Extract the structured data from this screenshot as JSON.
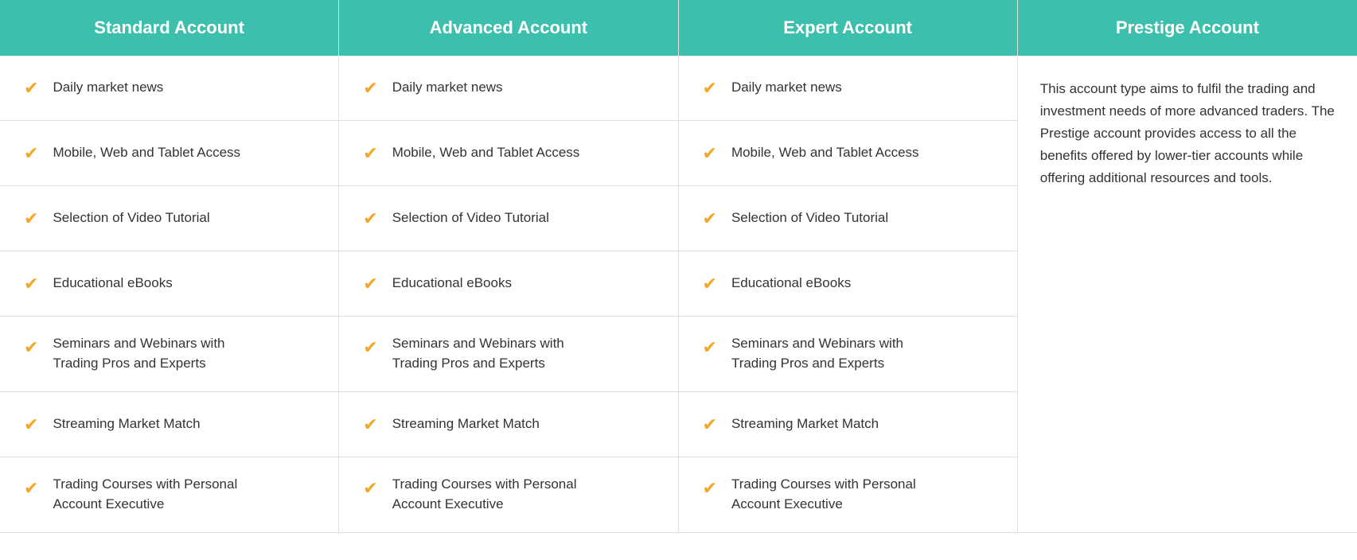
{
  "headers": [
    {
      "label": "Standard Account"
    },
    {
      "label": "Advanced Account"
    },
    {
      "label": "Expert Account"
    },
    {
      "label": "Prestige Account"
    }
  ],
  "prestige_description": "This account type aims to fulfil the trading and investment needs of more advanced traders. The Prestige account provides access to all the benefits offered by lower-tier accounts while offering additional resources and tools.",
  "features": [
    {
      "text": "Daily market news",
      "multiline": false,
      "line2": ""
    },
    {
      "text": "Mobile, Web and Tablet Access",
      "multiline": false,
      "line2": ""
    },
    {
      "text": "Selection of Video Tutorial",
      "multiline": false,
      "line2": ""
    },
    {
      "text": "Educational eBooks",
      "multiline": false,
      "line2": ""
    },
    {
      "text": "Seminars and Webinars with",
      "multiline": true,
      "line2": "Trading Pros and Experts"
    },
    {
      "text": "Streaming Market Match",
      "multiline": false,
      "line2": ""
    },
    {
      "text": "Trading Courses with Personal",
      "multiline": true,
      "line2": "Account Executive"
    }
  ],
  "checkmark": "✔",
  "colors": {
    "header_bg": "#3dbfad",
    "check_color": "#f5a623",
    "border_color": "#e0e0e0",
    "text_color": "#333333"
  }
}
